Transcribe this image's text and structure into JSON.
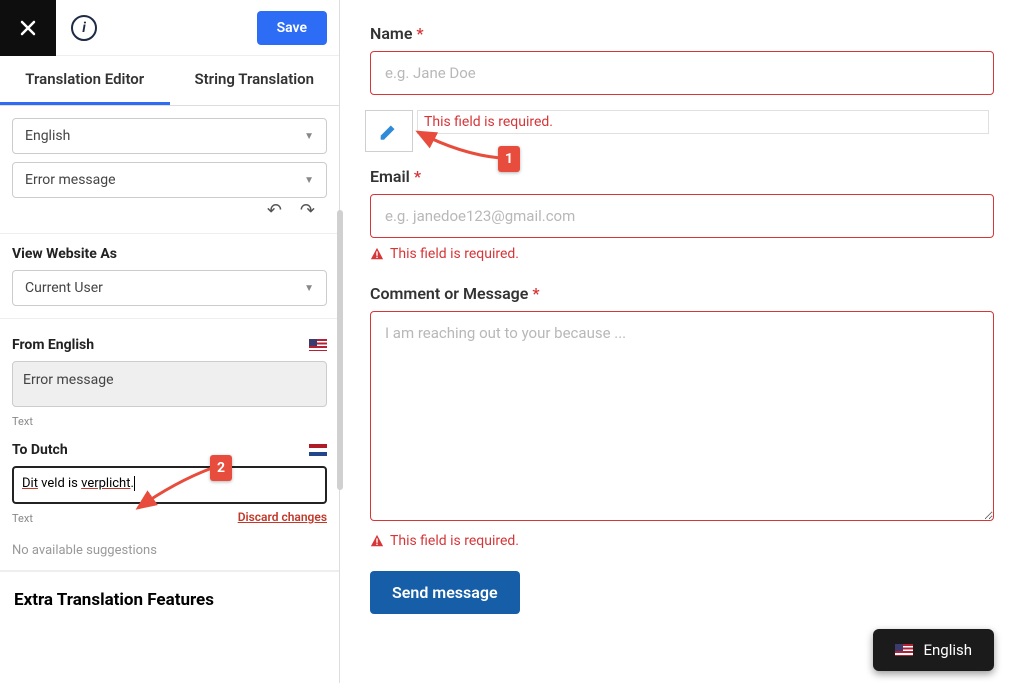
{
  "topbar": {
    "save_label": "Save"
  },
  "tabs": {
    "translation_editor": "Translation Editor",
    "string_translation": "String Translation"
  },
  "selectors": {
    "language": "English",
    "type": "Error message"
  },
  "view_as": {
    "label": "View Website As",
    "value": "Current User"
  },
  "from": {
    "label": "From English",
    "value": "Error message",
    "caption": "Text"
  },
  "to": {
    "label": "To Dutch",
    "value_parts": [
      "Dit",
      " veld is ",
      "verplicht",
      "."
    ],
    "caption": "Text",
    "discard": "Discard changes"
  },
  "suggestions": "No available suggestions",
  "extra_heading": "Extra Translation Features",
  "form": {
    "name": {
      "label": "Name",
      "placeholder": "e.g. Jane Doe"
    },
    "email": {
      "label": "Email",
      "placeholder": "e.g. janedoe123@gmail.com",
      "error": "This field is required."
    },
    "comment": {
      "label": "Comment or Message",
      "placeholder": "I am reaching out to your because ...",
      "error": "This field is required."
    },
    "inline_error": "This field is required.",
    "submit": "Send message"
  },
  "annotations": {
    "badge1": "1",
    "badge2": "2"
  },
  "lang_switcher": {
    "label": "English"
  }
}
